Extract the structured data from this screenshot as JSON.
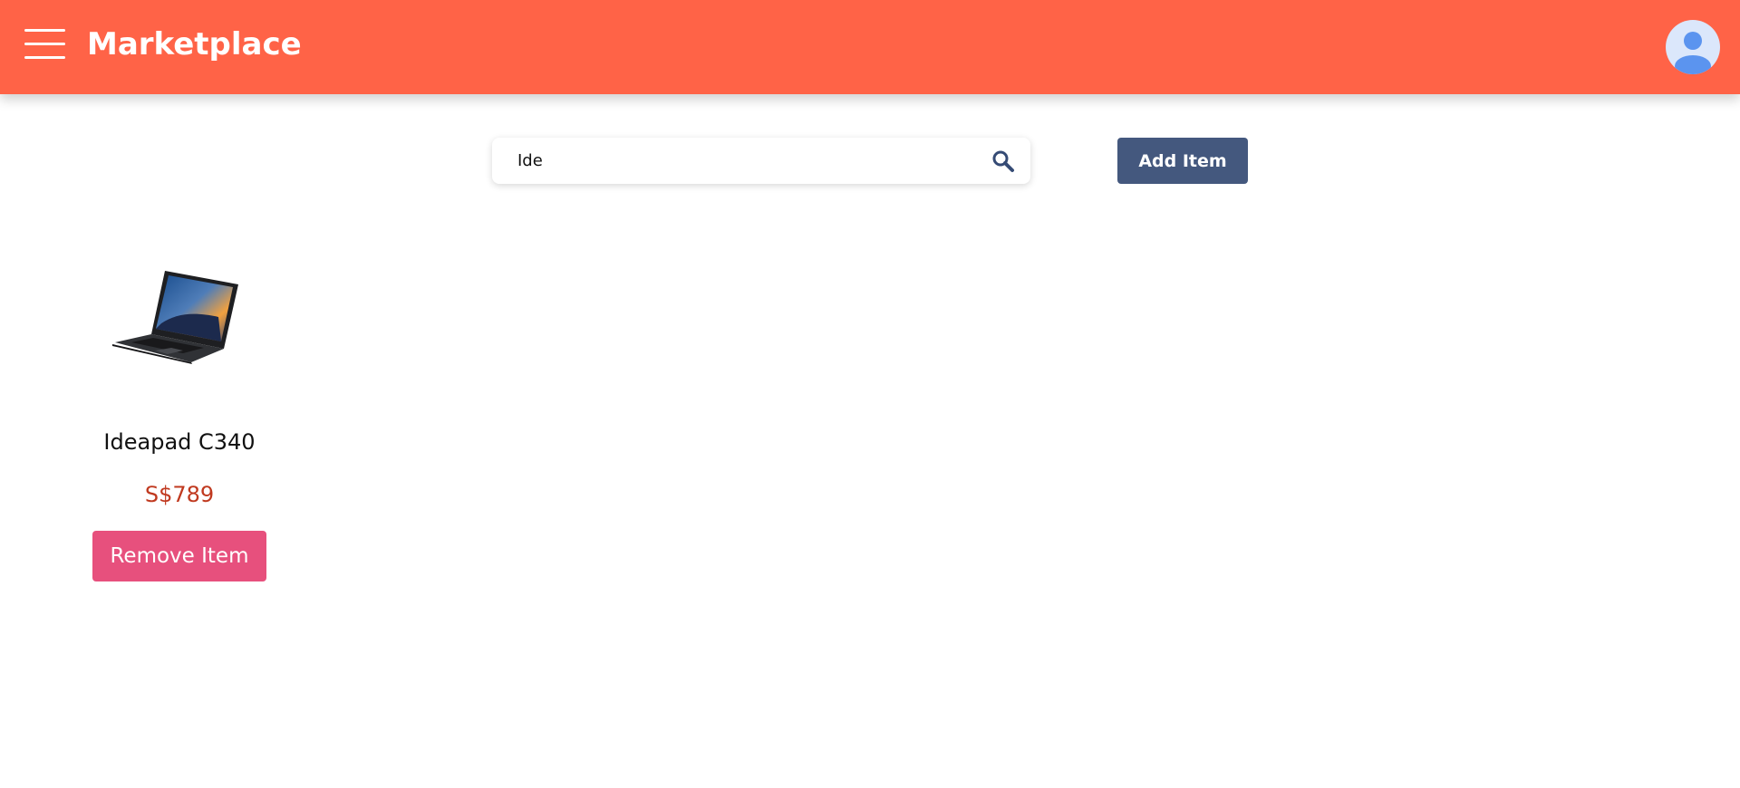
{
  "header": {
    "title": "Marketplace",
    "menu_icon": "hamburger-menu-icon",
    "avatar_icon": "user-avatar-icon",
    "background_color": "#ff6347"
  },
  "toolbar": {
    "search_value": "Ide",
    "search_icon": "search-icon",
    "add_button_label": "Add Item",
    "add_button_color": "#44587e"
  },
  "products": [
    {
      "name": "Ideapad C340",
      "price": "S$789",
      "image_icon": "laptop-image",
      "remove_label": "Remove Item",
      "remove_button_color": "#e7507d",
      "price_color": "#c0391f"
    }
  ]
}
